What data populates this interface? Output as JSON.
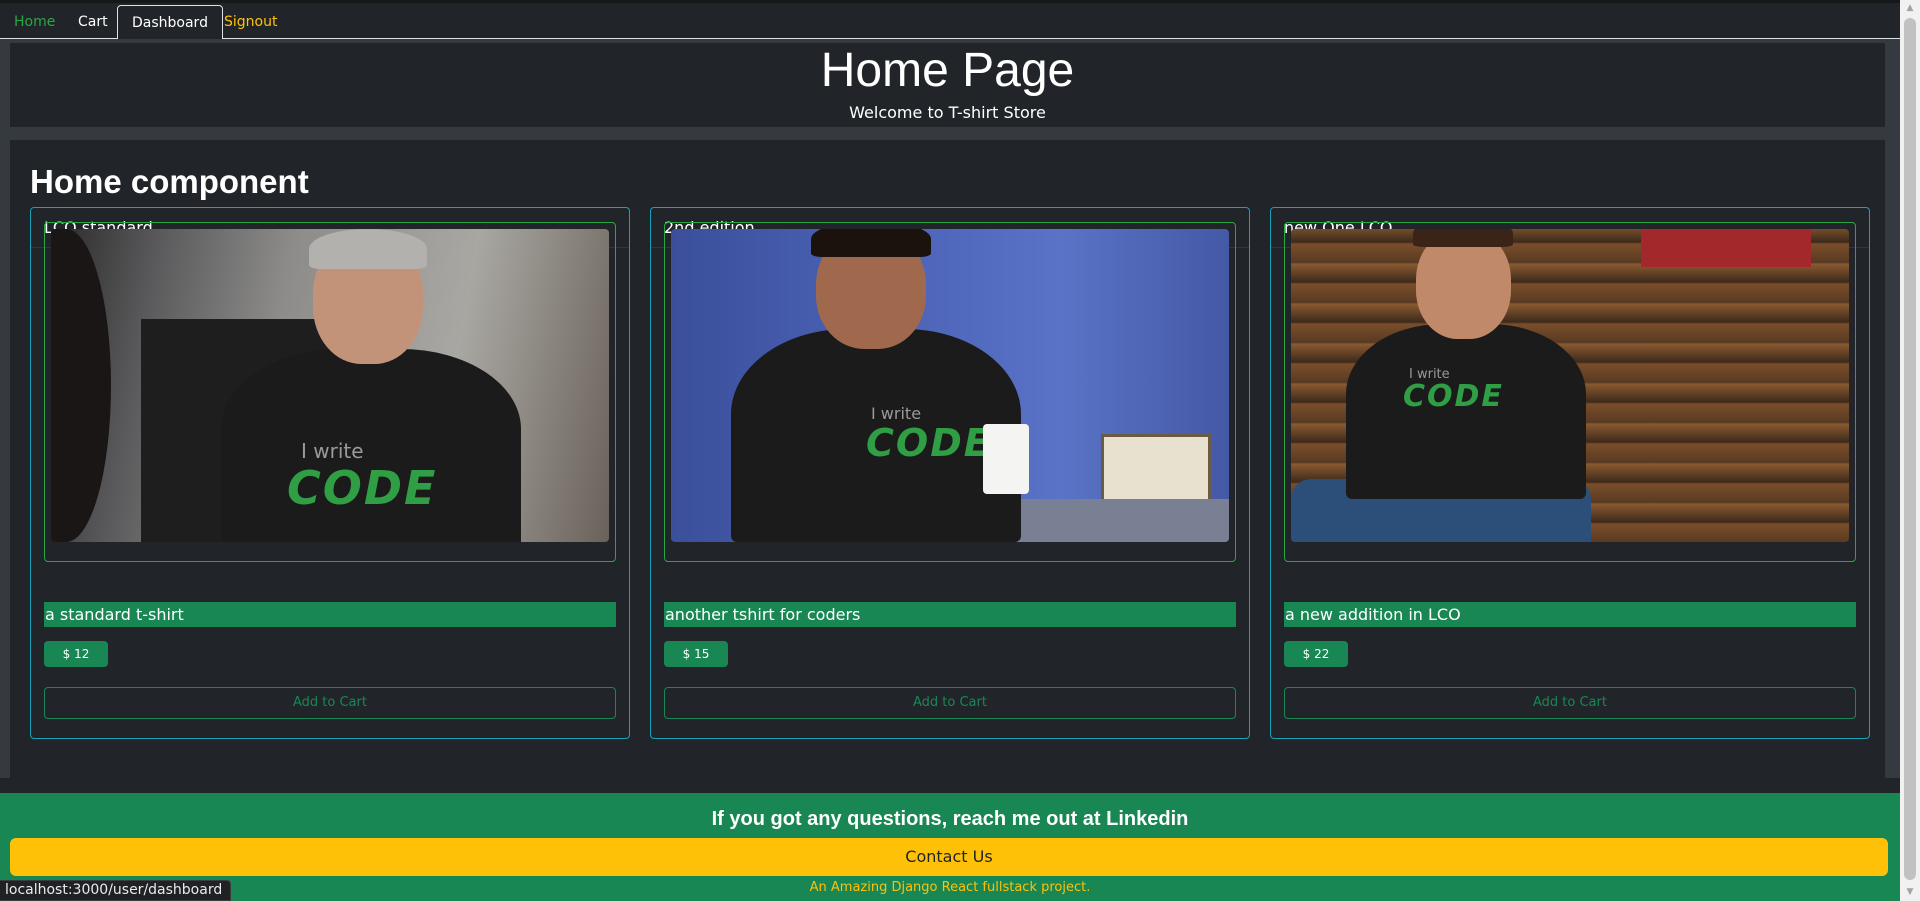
{
  "nav": {
    "items": [
      {
        "label": "Home"
      },
      {
        "label": "Cart"
      },
      {
        "label": "Dashboard"
      },
      {
        "label": "Signout"
      }
    ]
  },
  "header": {
    "title": "Home Page",
    "subtitle": "Welcome to T-shirt Store"
  },
  "main": {
    "heading": "Home component",
    "products": [
      {
        "name": "LCO standard",
        "description": "a standard t-shirt",
        "price": "$ 12",
        "button": "Add to Cart",
        "shirt_line1": "I write",
        "shirt_line2": "CODE"
      },
      {
        "name": "2nd edition",
        "description": "another tshirt for coders",
        "price": "$ 15",
        "button": "Add to Cart",
        "shirt_line1": "I write",
        "shirt_line2": "CODE"
      },
      {
        "name": "new One LCO",
        "description": "a new addition in LCO",
        "price": "$ 22",
        "button": "Add to Cart",
        "shirt_line1": "I write",
        "shirt_line2": "CODE"
      }
    ]
  },
  "footer": {
    "question": "If you got any questions, reach me out at Linkedin",
    "contact_label": "Contact Us",
    "tagline": "An Amazing Django React fullstack project."
  },
  "status_bar": {
    "url": "localhost:3000/user/dashboard"
  },
  "colors": {
    "background": "#212529",
    "success": "#198754",
    "warning": "#ffc107",
    "info": "#17a2b8"
  }
}
